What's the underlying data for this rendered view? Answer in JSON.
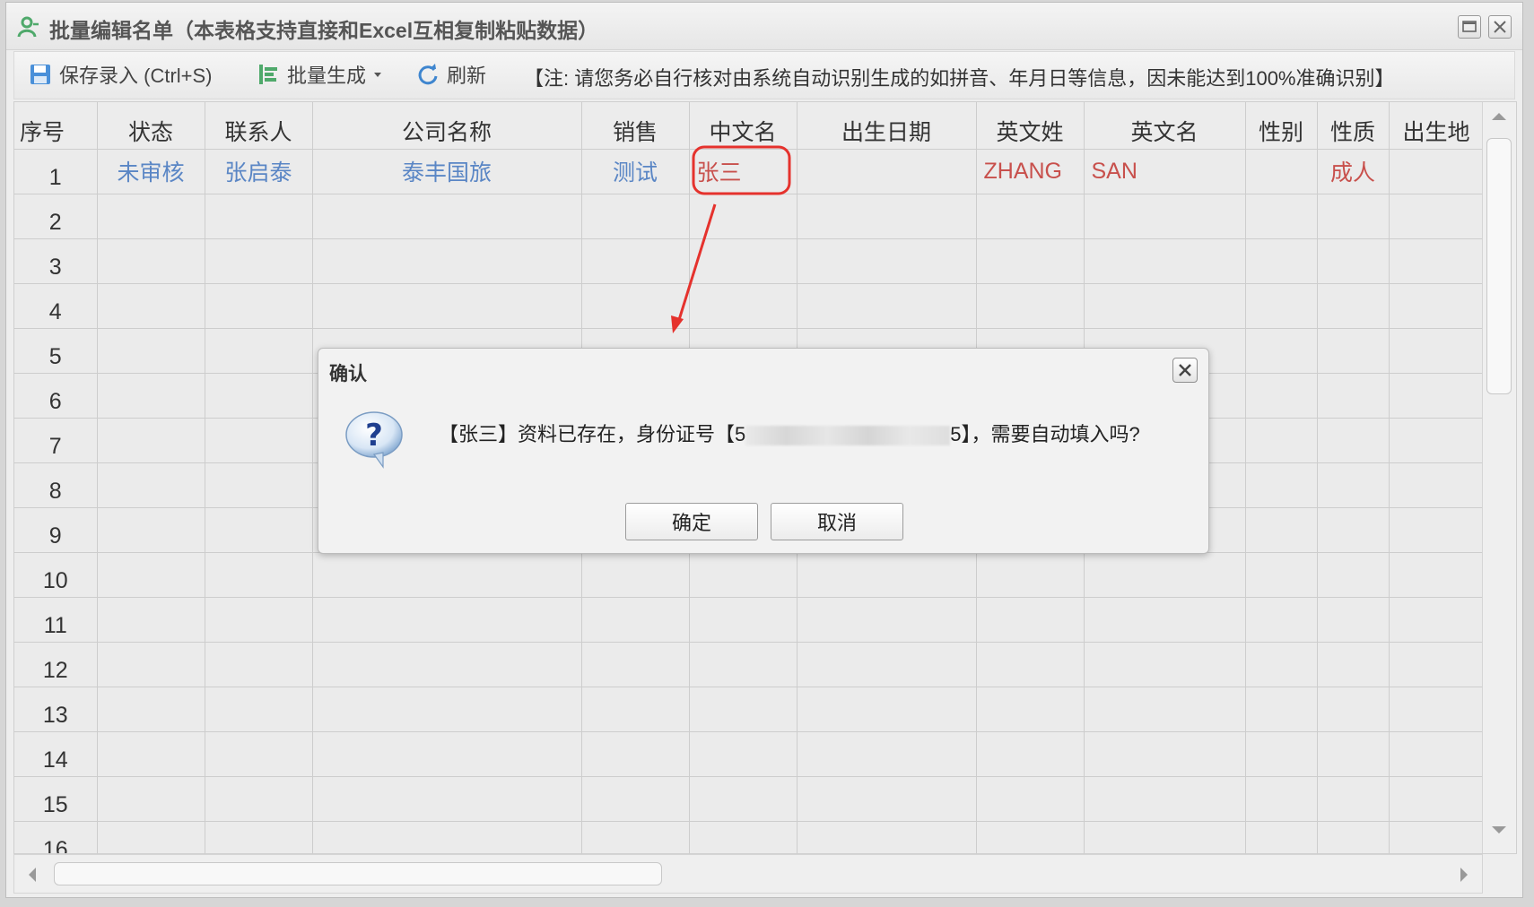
{
  "window": {
    "title": "批量编辑名单（本表格支持直接和Excel互相复制粘贴数据）"
  },
  "toolbar": {
    "save_label": "保存录入 (Ctrl+S)",
    "batch_label": "批量生成",
    "refresh_label": "刷新",
    "note": "【注: 请您务必自行核对由系统自动识别生成的如拼音、年月日等信息，因未能达到100%准确识别】"
  },
  "grid": {
    "columns": [
      "序号",
      "状态",
      "联系人",
      "公司名称",
      "销售",
      "中文名",
      "出生日期",
      "英文姓",
      "英文名",
      "性别",
      "性质",
      "出生地"
    ],
    "rows": [
      {
        "seq": "1",
        "status": "未审核",
        "contact": "张启泰",
        "company": "泰丰国旅",
        "sales": "测试",
        "cn_name": "张三",
        "birth": "",
        "en_last": "ZHANG",
        "en_first": "SAN",
        "gender": "",
        "nature": "成人",
        "birthplace": ""
      },
      {
        "seq": "2"
      },
      {
        "seq": "3"
      },
      {
        "seq": "4"
      },
      {
        "seq": "5"
      },
      {
        "seq": "6"
      },
      {
        "seq": "7"
      },
      {
        "seq": "8"
      },
      {
        "seq": "9"
      },
      {
        "seq": "10"
      },
      {
        "seq": "11"
      },
      {
        "seq": "12"
      },
      {
        "seq": "13"
      },
      {
        "seq": "14"
      },
      {
        "seq": "15"
      },
      {
        "seq": "16"
      }
    ]
  },
  "dialog": {
    "title": "确认",
    "message_prefix": "【张三】资料已存在，身份证号【5",
    "message_suffix": "5】，需要自动填入吗?",
    "ok_label": "确定",
    "cancel_label": "取消"
  },
  "colors": {
    "link_blue": "#5a86c5",
    "value_red": "#c8504c",
    "annotation_red": "#e5322d",
    "icon_green": "#4fa96b",
    "icon_blue": "#3f86cf"
  },
  "icons": {
    "title": "user-icon",
    "save": "floppy-disk-icon",
    "batch": "batch-generate-icon",
    "refresh": "refresh-icon",
    "dialog": "question-bubble-icon"
  }
}
